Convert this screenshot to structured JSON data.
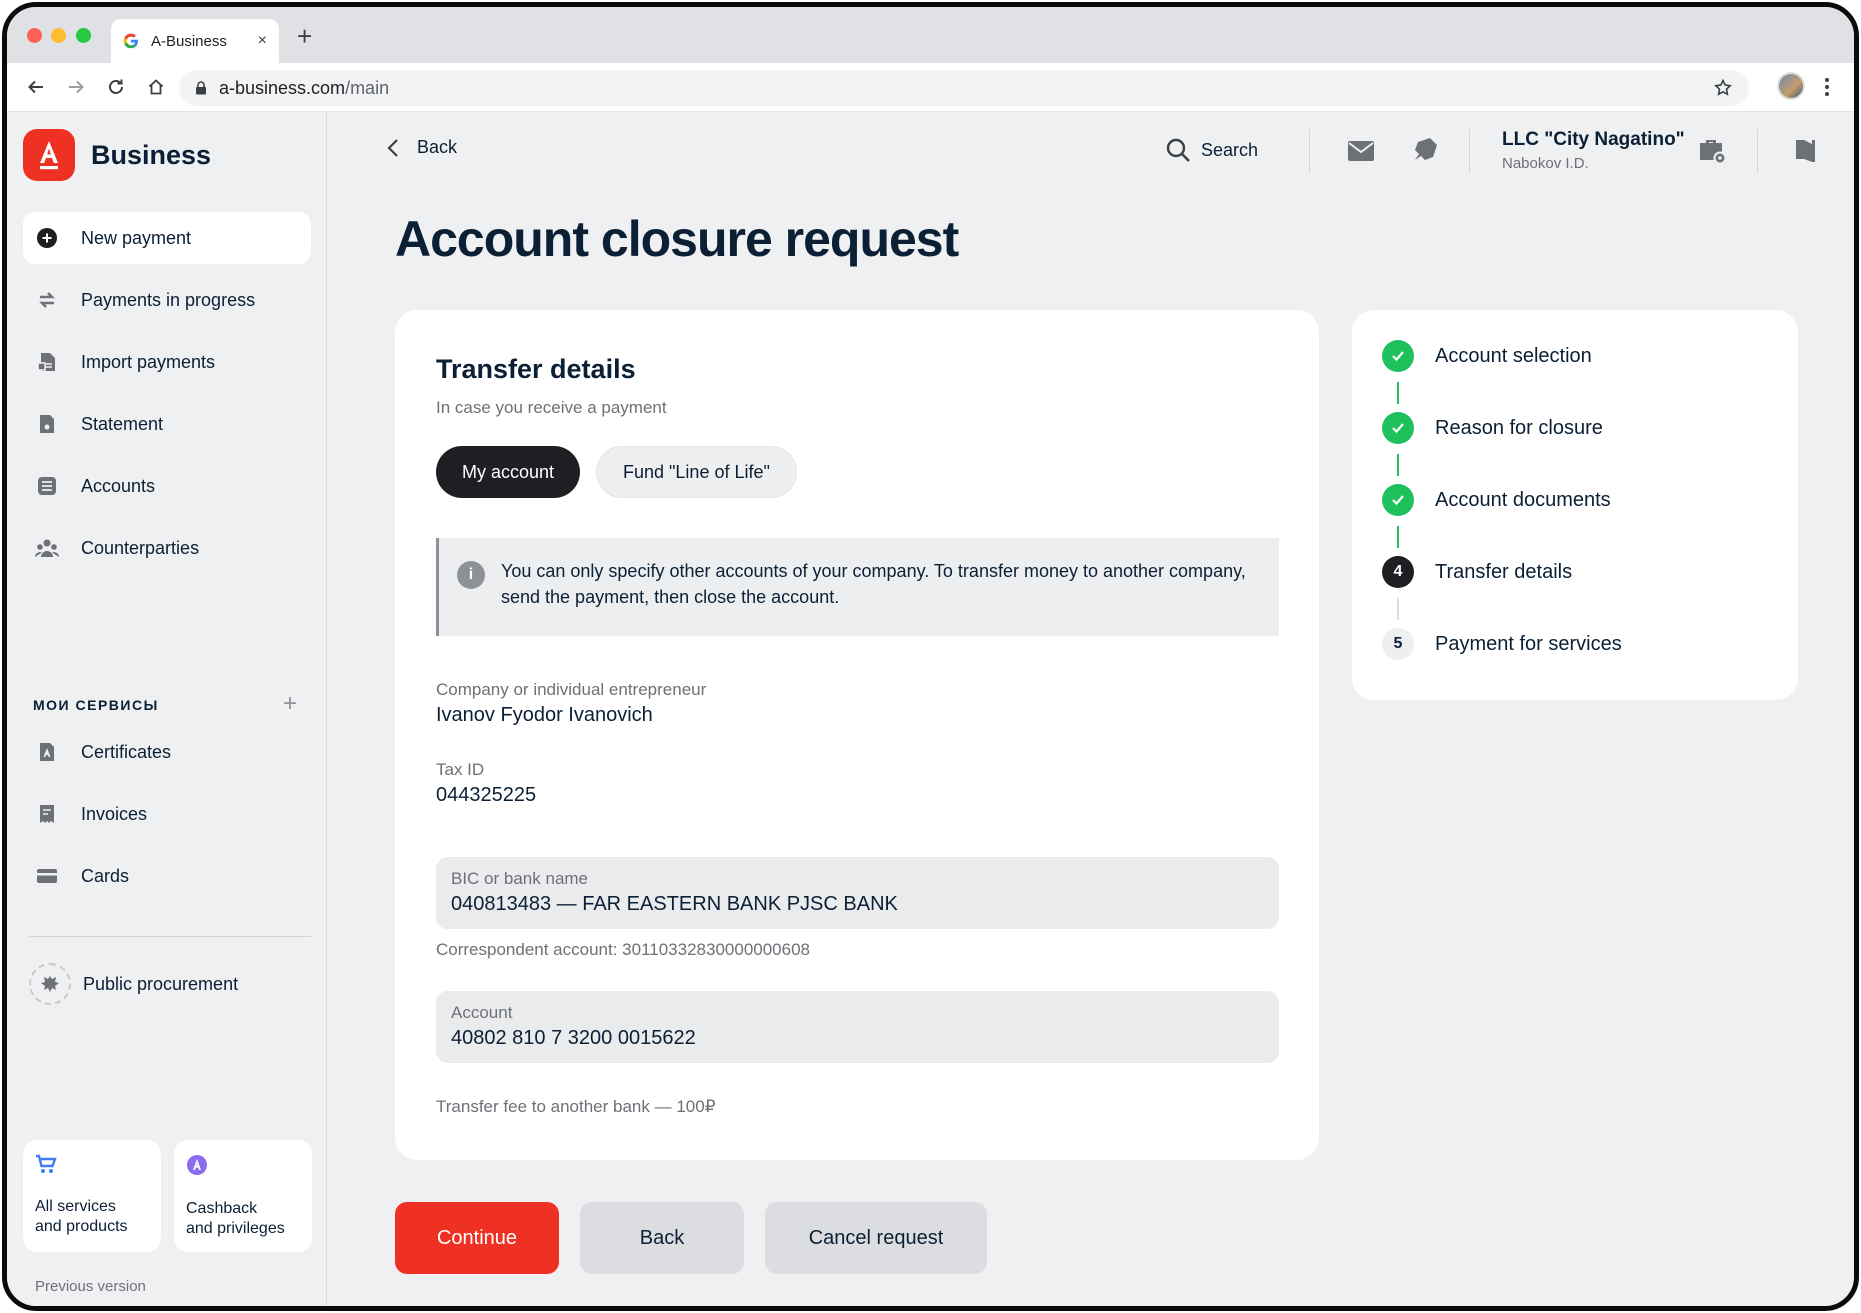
{
  "browser": {
    "tab_title": "A-Business",
    "new_tab_symbol": "+",
    "close_symbol": "×",
    "url_host": "a-business.com",
    "url_path": "/main"
  },
  "sidebar": {
    "brand": "Business",
    "brand_letter": "А",
    "items": [
      {
        "label": "New payment",
        "icon": "plus-circle-icon"
      },
      {
        "label": "Payments in progress",
        "icon": "arrows-exchange-icon"
      },
      {
        "label": "Import payments",
        "icon": "import-document-icon"
      },
      {
        "label": "Statement",
        "icon": "statement-icon"
      },
      {
        "label": "Accounts",
        "icon": "accounts-list-icon"
      },
      {
        "label": "Counterparties",
        "icon": "people-icon"
      }
    ],
    "section_title": "МОИ СЕРВИСЫ",
    "section_add": "+",
    "services": [
      {
        "label": "Certificates",
        "icon": "certificate-icon"
      },
      {
        "label": "Invoices",
        "icon": "invoice-icon"
      },
      {
        "label": "Cards",
        "icon": "card-icon"
      }
    ],
    "procurement": "Public procurement",
    "promo": [
      {
        "line1": "All services",
        "line2": "and products",
        "icon": "cart-icon"
      },
      {
        "line1": "Cashback",
        "line2": "and privileges",
        "icon": "cashback-icon"
      }
    ],
    "previous_version": "Previous version"
  },
  "header": {
    "back": "Back",
    "search": "Search",
    "company_name": "LLC \"City Nagatino\"",
    "company_user": "Nabokov I.D."
  },
  "page_title": "Account closure request",
  "form": {
    "title": "Transfer details",
    "subtitle": "In case you receive a payment",
    "chips": [
      "My account",
      "Fund \"Line of Life\""
    ],
    "notice_icon": "i",
    "notice": "You can only specify other accounts of your company. To transfer money to another company, send the payment, then close the account.",
    "company_label": "Company or individual entrepreneur",
    "company_value": "Ivanov Fyodor Ivanovich",
    "tax_label": "Tax ID",
    "tax_value": "044325225",
    "bic_label": "BIC or bank name",
    "bic_value": "040813483 — FAR EASTERN BANK PJSC BANK",
    "correspondent": "Correspondent account: 30110332830000000608",
    "account_label": "Account",
    "account_value": "40802 810 7 3200 0015622",
    "fee": "Transfer fee to another bank — 100₽"
  },
  "steps": [
    {
      "label": "Account selection",
      "status": "done"
    },
    {
      "label": "Reason for closure",
      "status": "done"
    },
    {
      "label": "Account documents",
      "status": "done"
    },
    {
      "label": "Transfer details",
      "status": "current",
      "number": "4"
    },
    {
      "label": "Payment for services",
      "status": "todo",
      "number": "5"
    }
  ],
  "actions": {
    "continue": "Continue",
    "back": "Back",
    "cancel": "Cancel request"
  },
  "colors": {
    "brand_red": "#ef3124",
    "success_green": "#1ec15c",
    "dark": "#1e1f23",
    "background": "#eff0f2"
  }
}
